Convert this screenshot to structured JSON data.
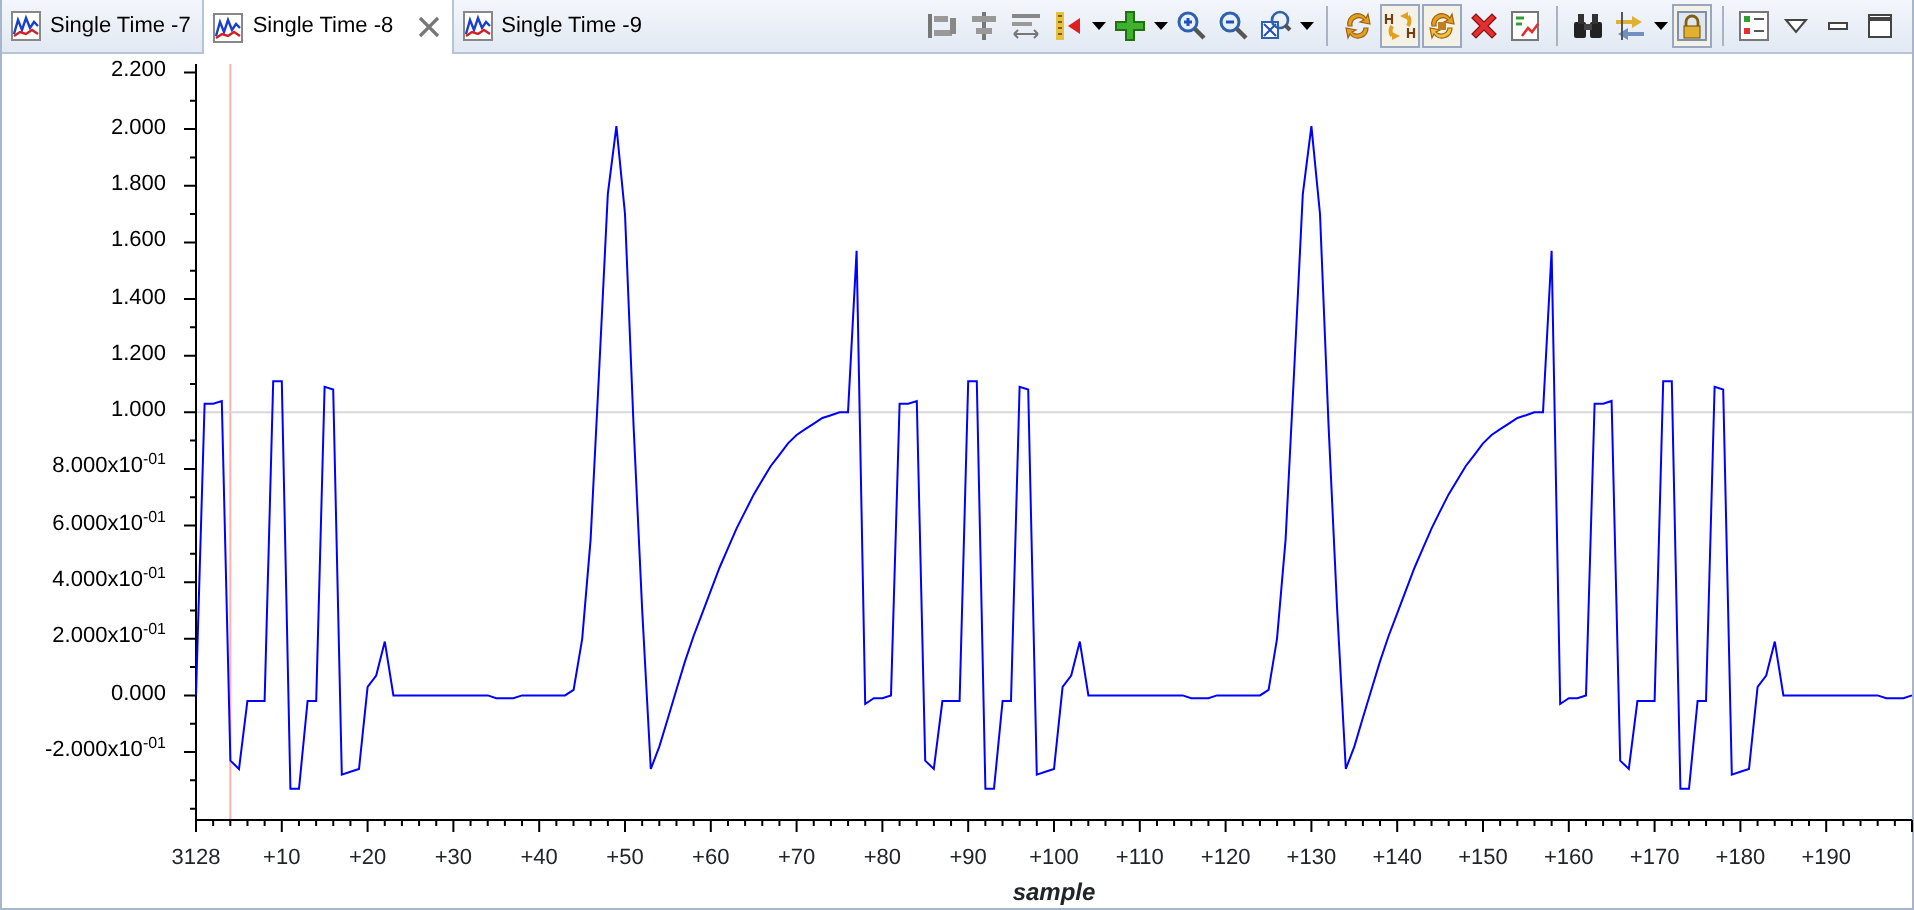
{
  "tabs": [
    {
      "label": "Single Time -7",
      "selected": false,
      "closable": false
    },
    {
      "label": "Single Time -8",
      "selected": true,
      "closable": true
    },
    {
      "label": "Single Time -9",
      "selected": false,
      "closable": false
    }
  ],
  "toolbar": [
    {
      "kind": "align-left",
      "pressed": false,
      "dropdown": false
    },
    {
      "kind": "align-center",
      "pressed": false,
      "dropdown": false
    },
    {
      "kind": "align-lines",
      "pressed": false,
      "dropdown": false
    },
    {
      "kind": "marker",
      "pressed": false,
      "dropdown": true
    },
    {
      "kind": "add",
      "pressed": false,
      "dropdown": true
    },
    {
      "kind": "zoom-in",
      "pressed": false,
      "dropdown": false
    },
    {
      "kind": "zoom-out",
      "pressed": false,
      "dropdown": false
    },
    {
      "kind": "zoom-fit",
      "pressed": false,
      "dropdown": true
    },
    {
      "kind": "separator"
    },
    {
      "kind": "sync",
      "pressed": false,
      "dropdown": false
    },
    {
      "kind": "sync-h",
      "pressed": true,
      "dropdown": false
    },
    {
      "kind": "sync-both",
      "pressed": true,
      "dropdown": false
    },
    {
      "kind": "delete",
      "pressed": false,
      "dropdown": false
    },
    {
      "kind": "properties",
      "pressed": false,
      "dropdown": false
    },
    {
      "kind": "separator"
    },
    {
      "kind": "find",
      "pressed": false,
      "dropdown": false
    },
    {
      "kind": "swap",
      "pressed": false,
      "dropdown": true
    },
    {
      "kind": "lock",
      "pressed": true,
      "dropdown": false
    },
    {
      "kind": "separator"
    },
    {
      "kind": "list",
      "pressed": false,
      "dropdown": false
    },
    {
      "kind": "view-menu",
      "pressed": false,
      "dropdown": false
    },
    {
      "kind": "minimize",
      "pressed": false,
      "dropdown": false
    },
    {
      "kind": "maximize",
      "pressed": false,
      "dropdown": false
    }
  ],
  "axis_origin": {
    "label": "3128"
  },
  "chart_data": {
    "type": "line",
    "xlabel": "sample",
    "xlim": [
      0,
      200
    ],
    "ylim": [
      -0.44,
      2.23
    ],
    "x": [
      0,
      1,
      2,
      3,
      4,
      5,
      6,
      7,
      8,
      9,
      10,
      11,
      12,
      13,
      14,
      15,
      16,
      17,
      18,
      19,
      20,
      21,
      22,
      23,
      24,
      25,
      26,
      27,
      28,
      29,
      30,
      31,
      32,
      33,
      34,
      35,
      36,
      37,
      38,
      39,
      40,
      41,
      42,
      43,
      44,
      45,
      46,
      47,
      48,
      49,
      50,
      51,
      52,
      53,
      54,
      55,
      56,
      57,
      58,
      59,
      60,
      61,
      62,
      63,
      64,
      65,
      66,
      67,
      68,
      69,
      70,
      71,
      72,
      73,
      74,
      75,
      76,
      77,
      78,
      79,
      80,
      81,
      82,
      83,
      84,
      85,
      86,
      87,
      88,
      89,
      90,
      91,
      92,
      93,
      94,
      95,
      96,
      97,
      98,
      99,
      100,
      101,
      102,
      103,
      104,
      105,
      106,
      107,
      108,
      109,
      110,
      111,
      112,
      113,
      114,
      115,
      116,
      117,
      118,
      119,
      120,
      121,
      122,
      123,
      124,
      125,
      126,
      127,
      128,
      129,
      130,
      131,
      132,
      133,
      134,
      135,
      136,
      137,
      138,
      139,
      140,
      141,
      142,
      143,
      144,
      145,
      146,
      147,
      148,
      149,
      150,
      151,
      152,
      153,
      154,
      155,
      156,
      157,
      158,
      159,
      160,
      161,
      162,
      163,
      164,
      165,
      166,
      167,
      168,
      169,
      170,
      171,
      172,
      173,
      174,
      175,
      176,
      177,
      178,
      179,
      180,
      181,
      182,
      183,
      184,
      185,
      186,
      187,
      188,
      189,
      190,
      191,
      192,
      193,
      194,
      195,
      196,
      197,
      198,
      199,
      200
    ],
    "xticks": [
      {
        "value": 10,
        "label": "+10"
      },
      {
        "value": 20,
        "label": "+20"
      },
      {
        "value": 30,
        "label": "+30"
      },
      {
        "value": 40,
        "label": "+40"
      },
      {
        "value": 50,
        "label": "+50"
      },
      {
        "value": 60,
        "label": "+60"
      },
      {
        "value": 70,
        "label": "+70"
      },
      {
        "value": 80,
        "label": "+80"
      },
      {
        "value": 90,
        "label": "+90"
      },
      {
        "value": 100,
        "label": "+100"
      },
      {
        "value": 110,
        "label": "+110"
      },
      {
        "value": 120,
        "label": "+120"
      },
      {
        "value": 130,
        "label": "+130"
      },
      {
        "value": 140,
        "label": "+140"
      },
      {
        "value": 150,
        "label": "+150"
      },
      {
        "value": 160,
        "label": "+160"
      },
      {
        "value": 170,
        "label": "+170"
      },
      {
        "value": 180,
        "label": "+180"
      },
      {
        "value": 190,
        "label": "+190"
      }
    ],
    "yticks": [
      {
        "value": 2.2,
        "label": "2.200"
      },
      {
        "value": 2.0,
        "label": "2.000"
      },
      {
        "value": 1.8,
        "label": "1.800"
      },
      {
        "value": 1.6,
        "label": "1.600"
      },
      {
        "value": 1.4,
        "label": "1.400"
      },
      {
        "value": 1.2,
        "label": "1.200"
      },
      {
        "value": 1.0,
        "label": "1.000"
      },
      {
        "value": 0.8,
        "label": "8.000x10$^{-01}$"
      },
      {
        "value": 0.6,
        "label": "6.000x10$^{-01}$"
      },
      {
        "value": 0.4,
        "label": "4.000x10$^{-01}$"
      },
      {
        "value": 0.2,
        "label": "2.000x10$^{-01}$"
      },
      {
        "value": 0,
        "label": "0.000"
      },
      {
        "value": -0.2,
        "label": "-2.000x10$^{-01}$"
      }
    ],
    "ref_lines": [
      {
        "axis": "x",
        "value": 4
      },
      {
        "axis": "y",
        "value": 1.0
      }
    ],
    "series": [
      {
        "color": "#0000ff",
        "values": [
          0,
          1.03,
          1.03,
          1.04,
          -0.23,
          -0.26,
          -0.02,
          -0.02,
          -0.02,
          1.11,
          1.11,
          -0.33,
          -0.33,
          -0.02,
          -0.02,
          1.09,
          1.08,
          -0.28,
          -0.27,
          -0.26,
          0.03,
          0.07,
          0.19,
          0,
          0,
          0,
          0,
          0,
          0,
          0,
          0,
          0,
          0,
          0,
          0,
          -0.01,
          -0.01,
          -0.01,
          0,
          0,
          0,
          0,
          0,
          0,
          0.02,
          0.2,
          0.55,
          1.15,
          1.77,
          2.01,
          1.7,
          0.95,
          0.3,
          -0.26,
          -0.18,
          -0.08,
          0.02,
          0.12,
          0.21,
          0.29,
          0.37,
          0.45,
          0.52,
          0.59,
          0.65,
          0.71,
          0.76,
          0.81,
          0.85,
          0.89,
          0.92,
          0.94,
          0.96,
          0.98,
          0.99,
          1.0,
          1.0,
          1.57,
          -0.03,
          -0.01,
          -0.01,
          0,
          1.03,
          1.03,
          1.04,
          -0.23,
          -0.26,
          -0.02,
          -0.02,
          -0.02,
          1.11,
          1.11,
          -0.33,
          -0.33,
          -0.02,
          -0.02,
          1.09,
          1.08,
          -0.28,
          -0.27,
          -0.26,
          0.03,
          0.07,
          0.19,
          0,
          0,
          0,
          0,
          0,
          0,
          0,
          0,
          0,
          0,
          0,
          0,
          -0.01,
          -0.01,
          -0.01,
          0,
          0,
          0,
          0,
          0,
          0,
          0.02,
          0.2,
          0.55,
          1.15,
          1.77,
          2.01,
          1.7,
          0.95,
          0.3,
          -0.26,
          -0.18,
          -0.08,
          0.02,
          0.12,
          0.21,
          0.29,
          0.37,
          0.45,
          0.52,
          0.59,
          0.65,
          0.71,
          0.76,
          0.81,
          0.85,
          0.89,
          0.92,
          0.94,
          0.96,
          0.98,
          0.99,
          1.0,
          1.0,
          1.57,
          -0.03,
          -0.01,
          -0.01,
          0,
          1.03,
          1.03,
          1.04,
          -0.23,
          -0.26,
          -0.02,
          -0.02,
          -0.02,
          1.11,
          1.11,
          -0.33,
          -0.33,
          -0.02,
          -0.02,
          1.09,
          1.08,
          -0.28,
          -0.27,
          -0.26,
          0.03,
          0.07,
          0.19,
          0,
          0,
          0,
          0,
          0,
          0,
          0,
          0,
          0,
          0,
          0,
          0,
          -0.01,
          -0.01,
          -0.01,
          0
        ]
      }
    ]
  }
}
